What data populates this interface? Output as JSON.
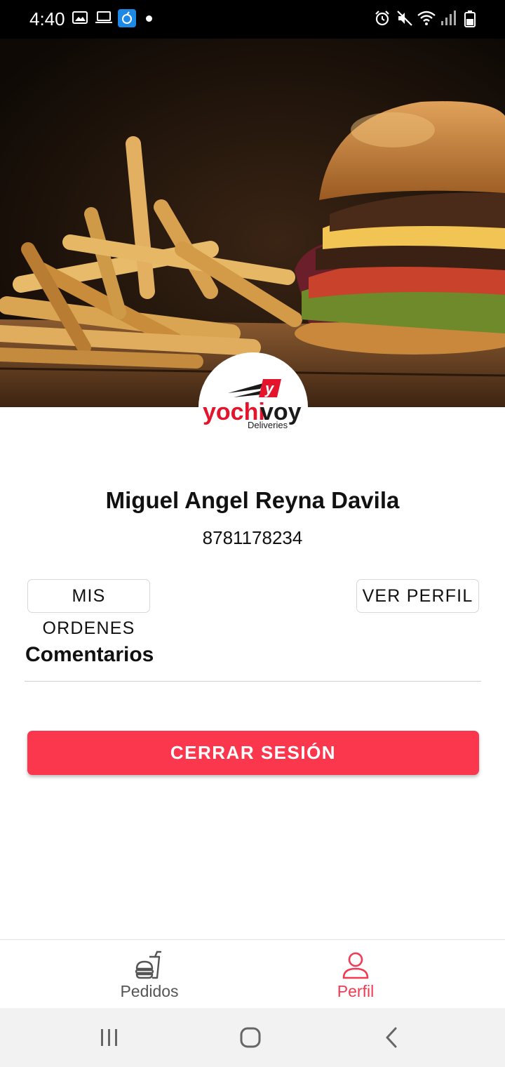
{
  "status_bar": {
    "time": "4:40",
    "left_icons": [
      "image-icon",
      "laptop-icon",
      "app-notification-icon",
      "dot-icon"
    ],
    "right_icons": [
      "alarm-icon",
      "mute-icon",
      "wifi-icon",
      "signal-icon",
      "battery-icon"
    ]
  },
  "hero": {
    "image": "burger-and-fries-photo"
  },
  "logo": {
    "badge_letter": "y",
    "brand_part1": "yochi",
    "brand_part2": "voy",
    "tagline": "Deliveries",
    "colors": {
      "red": "#e3142b",
      "dark": "#1a1a1a"
    }
  },
  "profile": {
    "name": "Miguel Angel Reyna Davila",
    "phone": "8781178234"
  },
  "actions": {
    "orders_label": "MIS ORDENES",
    "view_profile_label": "VER PERFIL"
  },
  "comments": {
    "title": "Comentarios"
  },
  "logout": {
    "label": "CERRAR SESIÓN",
    "color": "#fb374d"
  },
  "bottom_nav": {
    "items": [
      {
        "label": "Pedidos",
        "icon": "fast-food-icon",
        "active": false
      },
      {
        "label": "Perfil",
        "icon": "user-icon",
        "active": true
      }
    ],
    "active_color": "#f23a52",
    "inactive_color": "#555555"
  },
  "system_nav": {
    "buttons": [
      "recent-apps-icon",
      "home-icon",
      "back-icon"
    ]
  }
}
